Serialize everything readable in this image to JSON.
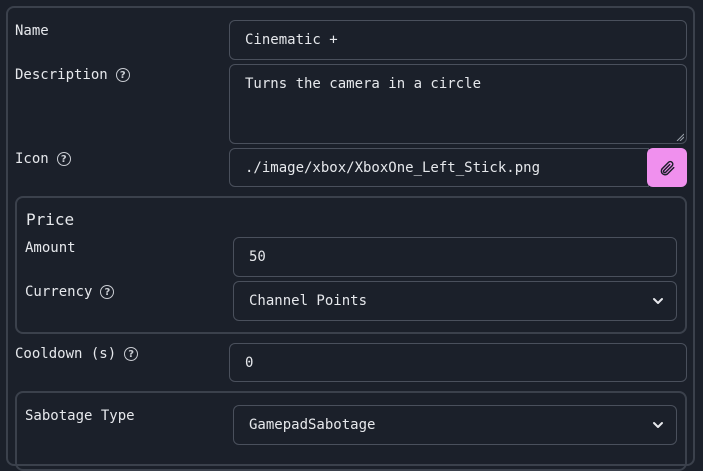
{
  "form": {
    "name": {
      "label": "Name",
      "value": "Cinematic +"
    },
    "description": {
      "label": "Description",
      "value": "Turns the camera in a circle",
      "help_icon": "help-circle-icon"
    },
    "icon": {
      "label": "Icon",
      "value": "./image/xbox/XboxOne_Left_Stick.png",
      "help_icon": "help-circle-icon",
      "attach_icon": "paperclip-icon",
      "attach_color": "#f090ee"
    },
    "price": {
      "title": "Price",
      "amount": {
        "label": "Amount",
        "value": "50"
      },
      "currency": {
        "label": "Currency",
        "value": "Channel Points",
        "help_icon": "help-circle-icon"
      }
    },
    "cooldown": {
      "label": "Cooldown (s)",
      "value": "0",
      "help_icon": "help-circle-icon"
    },
    "sabotage": {
      "label": "Sabotage Type",
      "value": "GamepadSabotage"
    }
  },
  "help_symbol": "?"
}
